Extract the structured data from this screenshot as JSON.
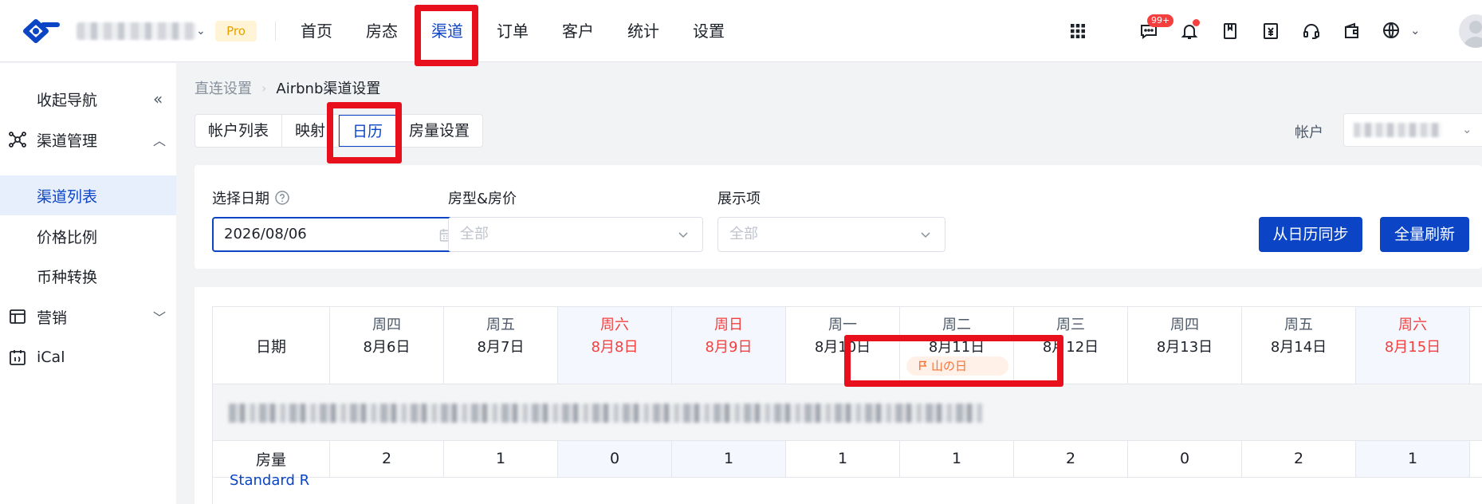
{
  "topbar": {
    "brand_badge": "Pro",
    "nav": [
      {
        "label": "首页",
        "active": false
      },
      {
        "label": "房态",
        "active": false
      },
      {
        "label": "渠道",
        "active": true
      },
      {
        "label": "订单",
        "active": false
      },
      {
        "label": "客户",
        "active": false
      },
      {
        "label": "统计",
        "active": false
      },
      {
        "label": "设置",
        "active": false
      }
    ],
    "message_badge": "99+",
    "accent_color": "#0b44c4",
    "badge_color": "#f53f3f"
  },
  "sidebar": {
    "collapse_label": "收起导航",
    "channel_mgmt": "渠道管理",
    "channel_list": "渠道列表",
    "price_ratio": "价格比例",
    "currency_convert": "币种转换",
    "marketing": "营销",
    "ical": "iCal"
  },
  "breadcrumb": {
    "parent": "直连设置",
    "current": "Airbnb渠道设置"
  },
  "tabs": [
    {
      "label": "帐户列表",
      "active": false
    },
    {
      "label": "映射",
      "active": false
    },
    {
      "label": "日历",
      "active": true
    },
    {
      "label": "房量设置",
      "active": false
    }
  ],
  "account": {
    "label": "帐户"
  },
  "filters": {
    "date_label": "选择日期",
    "date_value": "2026/08/06",
    "room_label": "房型&房价",
    "room_placeholder": "全部",
    "display_label": "展示项",
    "display_placeholder": "全部",
    "sync_button": "从日历同步",
    "refresh_button": "全量刷新"
  },
  "calendar": {
    "date_header": "日期",
    "days": [
      {
        "weekday": "周四",
        "date": "8月6日",
        "weekend": false
      },
      {
        "weekday": "周五",
        "date": "8月7日",
        "weekend": false
      },
      {
        "weekday": "周六",
        "date": "8月8日",
        "weekend": true
      },
      {
        "weekday": "周日",
        "date": "8月9日",
        "weekend": true
      },
      {
        "weekday": "周一",
        "date": "8月10日",
        "weekend": false
      },
      {
        "weekday": "周二",
        "date": "8月11日",
        "weekend": false
      },
      {
        "weekday": "周三",
        "date": "8月12日",
        "weekend": false
      },
      {
        "weekday": "周四",
        "date": "8月13日",
        "weekend": false
      },
      {
        "weekday": "周五",
        "date": "8月14日",
        "weekend": false
      },
      {
        "weekday": "周六",
        "date": "8月15日",
        "weekend": true
      }
    ],
    "holiday": "山の日",
    "qty_label": "房量",
    "quantities": [
      "2",
      "1",
      "0",
      "1",
      "1",
      "1",
      "2",
      "0",
      "2",
      "1"
    ],
    "next_row_partial": "Standard R"
  }
}
